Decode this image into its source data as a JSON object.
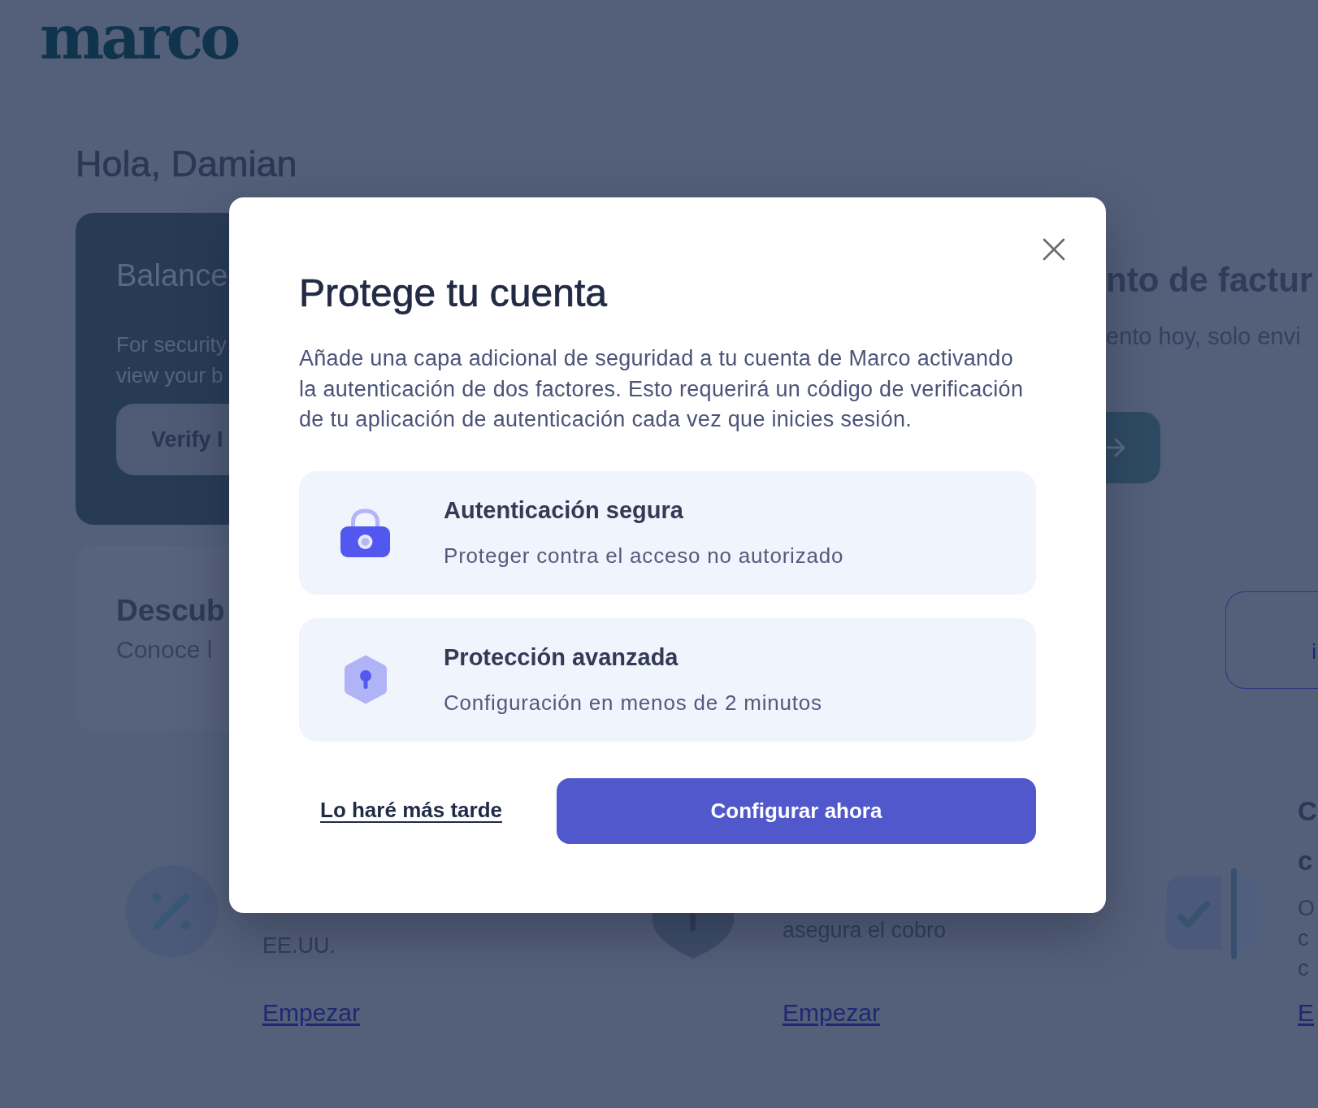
{
  "header": {
    "logo": "marco"
  },
  "greeting": "Hola, Damian",
  "balance_card": {
    "title": "Balance",
    "lines": [
      "For security",
      "view your b"
    ],
    "button": "Verify I"
  },
  "right_card": {
    "title": "nto de factur",
    "subtitle": "ento hoy, solo envi"
  },
  "promo_card": {
    "title": "Descub",
    "subtitle": "Conoce l"
  },
  "outline_button": {
    "label": "i"
  },
  "feature_cards": [
    {
      "kind": "percent",
      "body": [
        "EE.UU."
      ],
      "link": "Empezar"
    },
    {
      "kind": "shield",
      "body": [
        "asegura el cobro"
      ],
      "link": "Empezar"
    },
    {
      "kind": "checklist",
      "heading": [
        "C",
        "c"
      ],
      "body": [
        "O",
        "c",
        "c"
      ],
      "link": "E"
    }
  ],
  "modal": {
    "title": "Protege tu cuenta",
    "description": "Añade una capa adicional de seguridad a tu cuenta de Marco activando la autenticación de dos factores. Esto requerirá un código de verificación de tu aplicación de autenticación cada vez que inicies sesión.",
    "features": [
      {
        "kind": "lock",
        "title": "Autenticación segura",
        "subtitle": "Proteger contra el acceso no autorizado"
      },
      {
        "kind": "shield",
        "title": "Protección avanzada",
        "subtitle": "Configuración en menos de 2 minutos"
      }
    ],
    "secondary_action": "Lo haré más tarde",
    "primary_action": "Configurar ahora"
  }
}
